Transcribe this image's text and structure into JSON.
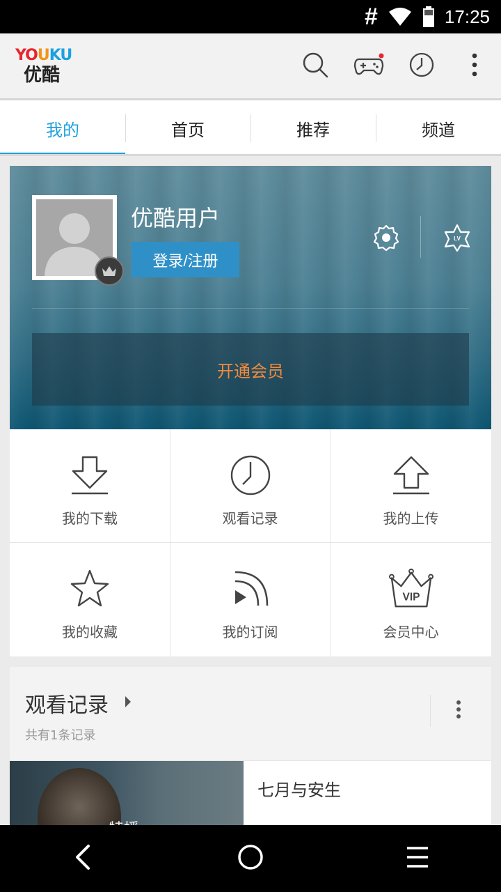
{
  "status_bar": {
    "signal_text": "#",
    "time": "17:25",
    "icons": [
      "wifi-icon",
      "battery-icon"
    ]
  },
  "app_bar": {
    "logo_en": [
      "YO",
      "U",
      "KU"
    ],
    "logo_cn": "优酷",
    "actions": [
      "search-icon",
      "game-controller-icon",
      "history-clock-icon",
      "overflow-menu-icon"
    ],
    "colors": {
      "brand_red": "#e7252d",
      "brand_orange": "#f19519",
      "brand_blue": "#1aa1e1"
    }
  },
  "tabs": [
    {
      "label": "我的",
      "active": true
    },
    {
      "label": "首页",
      "active": false
    },
    {
      "label": "推荐",
      "active": false
    },
    {
      "label": "频道",
      "active": false
    }
  ],
  "profile": {
    "username": "优酷用户",
    "login_label": "登录/注册",
    "settings_icon": "gear-icon",
    "level_icon": "level-star-icon",
    "level_text": "LV",
    "vip_label": "开通会员",
    "colors": {
      "accent": "#1d9fe0",
      "vip_text": "#f08a3c"
    }
  },
  "grid": {
    "items": [
      {
        "label": "我的下载",
        "icon": "download-icon"
      },
      {
        "label": "观看记录",
        "icon": "clock-icon"
      },
      {
        "label": "我的上传",
        "icon": "upload-icon"
      },
      {
        "label": "我的收藏",
        "icon": "star-icon"
      },
      {
        "label": "我的订阅",
        "icon": "subscribe-icon"
      },
      {
        "label": "会员中心",
        "icon": "vip-crown-icon"
      }
    ],
    "vip_badge_text": "VIP"
  },
  "history": {
    "title": "观看记录",
    "subtitle": "共有1条记录",
    "items": [
      {
        "title": "七月与安生",
        "thumb_caption": "特播"
      }
    ]
  },
  "nav_bar": [
    "back-icon",
    "home-icon",
    "menu-icon"
  ]
}
